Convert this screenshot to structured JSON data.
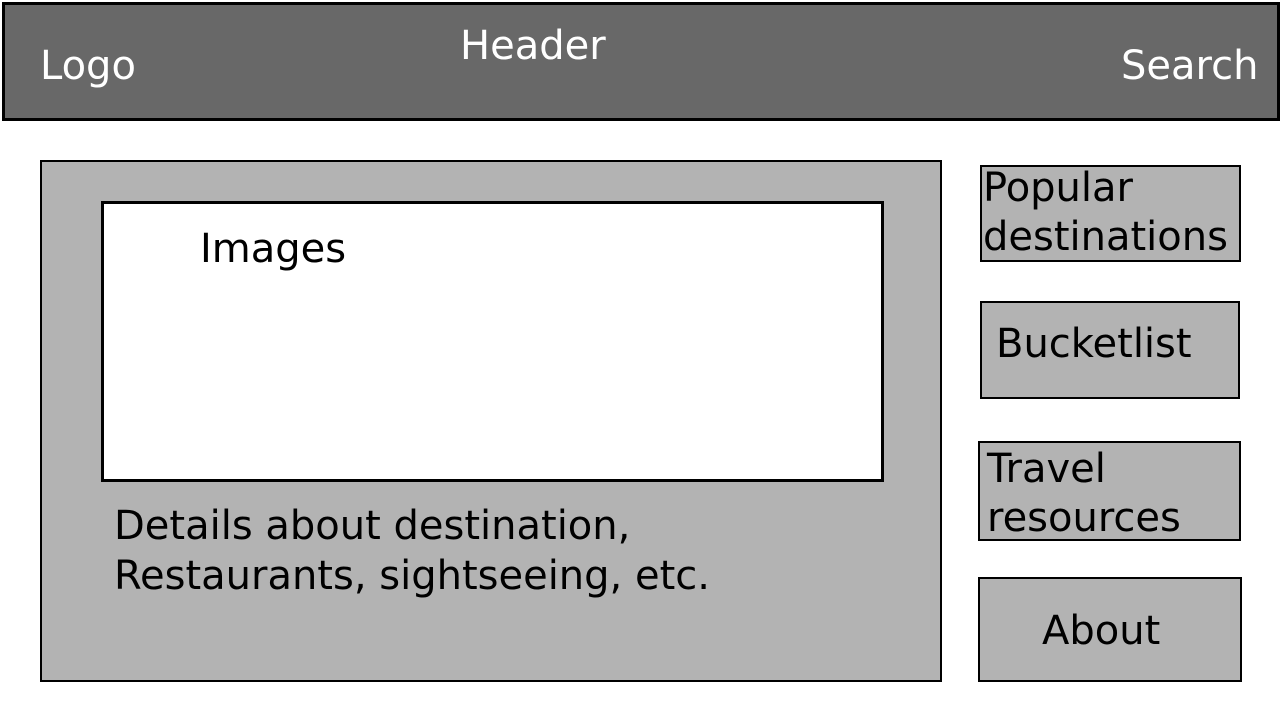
{
  "header": {
    "logo": "Logo",
    "title": "Header",
    "search": "Search"
  },
  "main": {
    "images_label": "Images",
    "details_line1": "Details about destination,",
    "details_line2": "Restaurants, sightseeing, etc."
  },
  "sidebar": {
    "items": [
      {
        "line1": "Popular",
        "line2": "destinations"
      },
      {
        "label": "Bucketlist"
      },
      {
        "line1": "Travel",
        "line2": "resources"
      },
      {
        "label": "About"
      }
    ]
  },
  "colors": {
    "header_fill": "#686868",
    "panel_fill": "#b3b3b3",
    "image_fill": "#ffffff",
    "header_text": "#ffffff",
    "body_text": "#000000"
  }
}
